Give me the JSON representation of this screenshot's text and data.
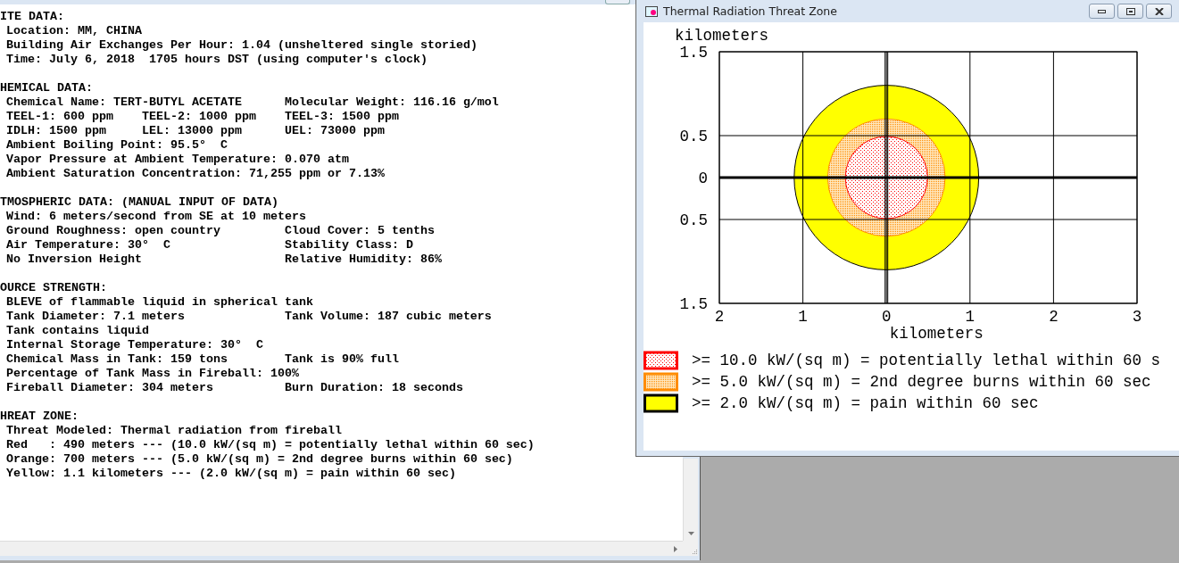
{
  "report_window": {
    "sections": [
      {
        "heading": "ITE DATA:",
        "lines": [
          {
            "left": "Location: MM, CHINA"
          },
          {
            "left": "Building Air Exchanges Per Hour: 1.04 (unsheltered single storied)"
          },
          {
            "left": "Time: July 6, 2018  1705 hours DST (using computer's clock)"
          }
        ]
      },
      {
        "heading": "HEMICAL DATA:",
        "lines": [
          {
            "left": "Chemical Name: TERT-BUTYL ACETATE",
            "right": "Molecular Weight: 116.16 g/mol"
          },
          {
            "left": "TEEL-1: 600 ppm    TEEL-2: 1000 ppm",
            "right": "TEEL-3: 1500 ppm"
          },
          {
            "left": "IDLH: 1500 ppm     LEL: 13000 ppm",
            "right": "UEL: 73000 ppm"
          },
          {
            "left": "Ambient Boiling Point: 95.5°  C"
          },
          {
            "left": "Vapor Pressure at Ambient Temperature: 0.070 atm"
          },
          {
            "left": "Ambient Saturation Concentration: 71,255 ppm or 7.13%"
          }
        ]
      },
      {
        "heading": "TMOSPHERIC DATA: (MANUAL INPUT OF DATA)",
        "lines": [
          {
            "left": "Wind: 6 meters/second from SE at 10 meters"
          },
          {
            "left": "Ground Roughness: open country",
            "right": "Cloud Cover: 5 tenths"
          },
          {
            "left": "Air Temperature: 30°  C",
            "right": "Stability Class: D"
          },
          {
            "left": "No Inversion Height",
            "right": "Relative Humidity: 86%"
          }
        ]
      },
      {
        "heading": "OURCE STRENGTH:",
        "lines": [
          {
            "left": "BLEVE of flammable liquid in spherical tank"
          },
          {
            "left": "Tank Diameter: 7.1 meters",
            "right": "Tank Volume: 187 cubic meters"
          },
          {
            "left": "Tank contains liquid"
          },
          {
            "left": "Internal Storage Temperature: 30°  C"
          },
          {
            "left": "Chemical Mass in Tank: 159 tons",
            "right": "Tank is 90% full"
          },
          {
            "left": "Percentage of Tank Mass in Fireball: 100%"
          },
          {
            "left": "Fireball Diameter: 304 meters",
            "right": "Burn Duration: 18 seconds"
          }
        ]
      },
      {
        "heading": "HREAT ZONE:",
        "lines": [
          {
            "left": "Threat Modeled: Thermal radiation from fireball"
          },
          {
            "left": "Red   : 490 meters --- (10.0 kW/(sq m) = potentially lethal within 60 sec)"
          },
          {
            "left": "Orange: 700 meters --- (5.0 kW/(sq m) = 2nd degree burns within 60 sec)"
          },
          {
            "left": "Yellow: 1.1 kilometers --- (2.0 kW/(sq m) = pain within 60 sec)"
          }
        ]
      }
    ]
  },
  "plot_window": {
    "title": "Thermal Radiation Threat Zone",
    "plot": {
      "xlabel": "kilometers",
      "ylabel": "kilometers",
      "xtick_labels": [
        "2",
        "1",
        "0",
        "1",
        "2",
        "3"
      ],
      "ytick_labels": [
        "1.5",
        "0.5",
        "0",
        "0.5",
        "1.5"
      ],
      "zones": [
        {
          "legend": ">= 10.0 kW/(sq m) = potentially lethal within 60 s",
          "color": "#ff0000"
        },
        {
          "legend": ">= 5.0 kW/(sq m) = 2nd degree burns within 60 sec",
          "color": "#ff8c00"
        },
        {
          "legend": ">= 2.0 kW/(sq m) = pain within 60 sec",
          "color": "#ffff00"
        }
      ]
    }
  }
}
